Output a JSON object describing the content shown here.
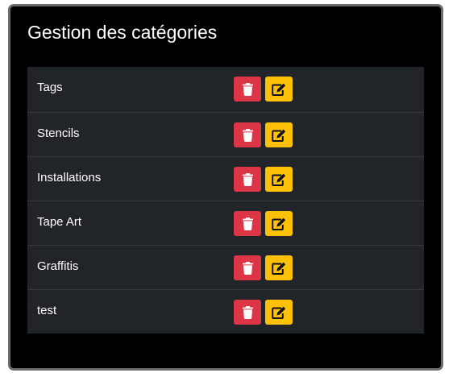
{
  "panel": {
    "title": "Gestion des catégories"
  },
  "categories": [
    {
      "name": "Tags"
    },
    {
      "name": "Stencils"
    },
    {
      "name": "Installations"
    },
    {
      "name": "Tape Art"
    },
    {
      "name": "Graffitis"
    },
    {
      "name": "test"
    }
  ],
  "actions": {
    "delete_icon": "trash-icon",
    "edit_icon": "edit-icon"
  },
  "colors": {
    "panel_bg": "#000000",
    "table_bg": "#212529",
    "delete": "#dc3545",
    "edit": "#ffc107"
  }
}
